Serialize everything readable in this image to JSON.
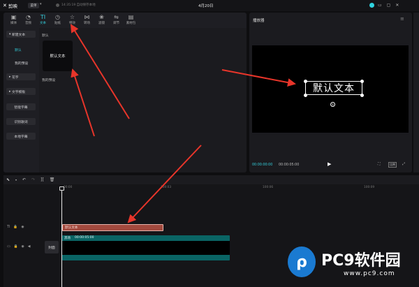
{
  "titlebar": {
    "app_name": "剪映",
    "menu_label": "菜单",
    "save_status": "14:35:19 自动保存本地",
    "project_title": "4月20日"
  },
  "toolbar": {
    "tabs": [
      {
        "label": "媒体",
        "icon": "media-icon"
      },
      {
        "label": "音频",
        "icon": "audio-icon"
      },
      {
        "label": "文本",
        "icon": "text-icon",
        "active": true
      },
      {
        "label": "贴纸",
        "icon": "sticker-icon"
      },
      {
        "label": "特效",
        "icon": "effects-icon"
      },
      {
        "label": "转场",
        "icon": "transition-icon"
      },
      {
        "label": "滤镜",
        "icon": "filter-icon"
      },
      {
        "label": "调节",
        "icon": "adjust-icon"
      },
      {
        "label": "素材包",
        "icon": "material-pack-icon"
      }
    ]
  },
  "sidebar": {
    "items": [
      {
        "label": "新建文本"
      },
      {
        "label": "默认"
      },
      {
        "label": "我的预设"
      },
      {
        "label": "花字"
      },
      {
        "label": "文字模板"
      },
      {
        "label": "智能字幕"
      },
      {
        "label": "识别歌词"
      },
      {
        "label": "本地字幕"
      }
    ]
  },
  "content": {
    "section_default": "默认",
    "card_label": "默认文本",
    "section_presets": "我的预设"
  },
  "player": {
    "title": "播放器",
    "canvas_text": "默认文本",
    "current_time": "00:00:00:00",
    "total_time": "00:00:05:00",
    "ratio_label": "比例"
  },
  "timeline": {
    "ticks": [
      "00:00",
      "100:03",
      "100:06",
      "100:09"
    ],
    "cover_label": "封面",
    "text_clip_label": "默认文本",
    "video_clip_name": "黑场",
    "video_clip_duration": "00:00:05:00"
  },
  "watermark": {
    "title": "PC9软件园",
    "url": "www.pc9.com"
  },
  "colors": {
    "accent": "#34d0dd",
    "text_clip": "#a2493d",
    "video_clip": "#0a6464",
    "arrow": "#e8352a"
  }
}
